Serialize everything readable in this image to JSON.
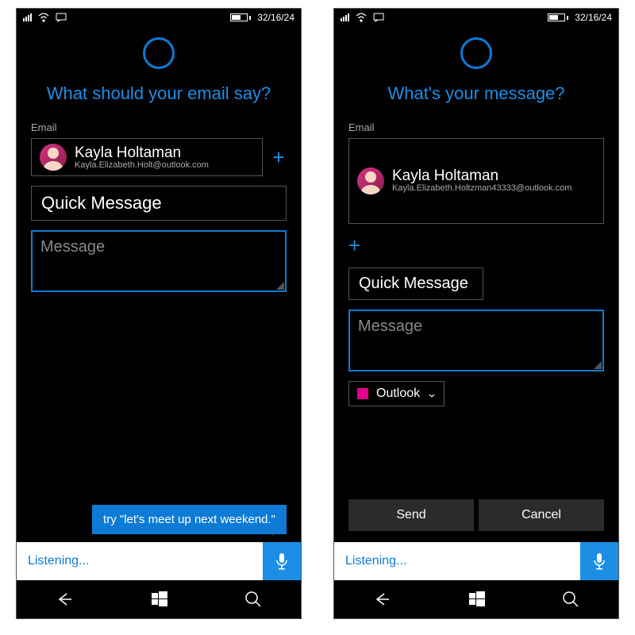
{
  "status": {
    "time": "32/16/24"
  },
  "panels": {
    "left": {
      "prompt": "What should your email say?",
      "section_label": "Email",
      "contact": {
        "name": "Kayla Holtaman",
        "email": "Kayla.Elizabeth.Holt@outlook.com"
      },
      "quick_msg": "Quick Message",
      "message_placeholder": "Message",
      "suggestion": "try \"let's meet up next weekend.\""
    },
    "right": {
      "prompt": "What's your message?",
      "section_label": "Email",
      "contact": {
        "name": "Kayla Holtaman",
        "email": "Kayla.Elizabeth.Holtzman43333@outlook.com"
      },
      "quick_msg": "Quick Message",
      "message_placeholder": "Message",
      "account": "Outlook",
      "send_label": "Send",
      "cancel_label": "Cancel"
    }
  },
  "listen": {
    "label": "Listening..."
  }
}
